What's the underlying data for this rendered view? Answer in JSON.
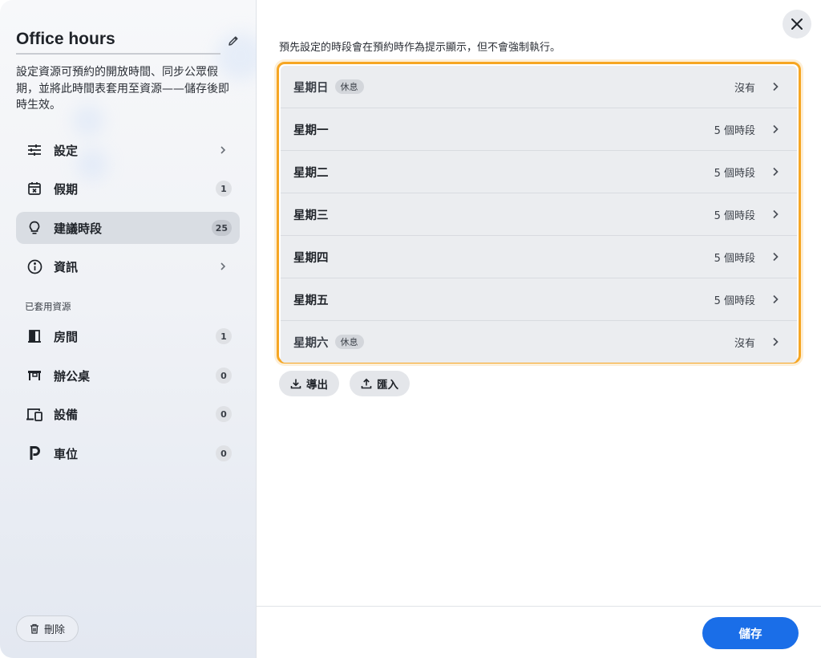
{
  "sidebar": {
    "title": "Office hours",
    "description": "設定資源可預約的開放時間、同步公眾假期，並將此時間表套用至資源——儲存後即時生效。",
    "nav": [
      {
        "label": "設定",
        "icon": "sliders-icon",
        "trailing": "chevron"
      },
      {
        "label": "假期",
        "icon": "calendar-x-icon",
        "badge": "1"
      },
      {
        "label": "建議時段",
        "icon": "lightbulb-icon",
        "badge": "25",
        "active": true
      },
      {
        "label": "資訊",
        "icon": "info-icon",
        "trailing": "chevron"
      }
    ],
    "section_label": "已套用資源",
    "resources": [
      {
        "label": "房間",
        "icon": "door-icon",
        "badge": "1"
      },
      {
        "label": "辦公桌",
        "icon": "desk-icon",
        "badge": "0"
      },
      {
        "label": "設備",
        "icon": "devices-icon",
        "badge": "0"
      },
      {
        "label": "車位",
        "icon": "parking-icon",
        "badge": "0"
      }
    ],
    "delete_label": "刪除"
  },
  "main": {
    "hint": "預先設定的時段會在預約時作為提示顯示，但不會強制執行。",
    "days": [
      {
        "name": "星期日",
        "tag": "休息",
        "count": "沒有"
      },
      {
        "name": "星期一",
        "tag": "",
        "count": "5 個時段"
      },
      {
        "name": "星期二",
        "tag": "",
        "count": "5 個時段"
      },
      {
        "name": "星期三",
        "tag": "",
        "count": "5 個時段"
      },
      {
        "name": "星期四",
        "tag": "",
        "count": "5 個時段"
      },
      {
        "name": "星期五",
        "tag": "",
        "count": "5 個時段"
      },
      {
        "name": "星期六",
        "tag": "休息",
        "count": "沒有"
      }
    ],
    "export_label": "導出",
    "import_label": "匯入",
    "save_label": "儲存"
  },
  "colors": {
    "accent": "#1a6ee8",
    "highlight_border": "#f6a623",
    "active_nav": "#d9dde3"
  }
}
